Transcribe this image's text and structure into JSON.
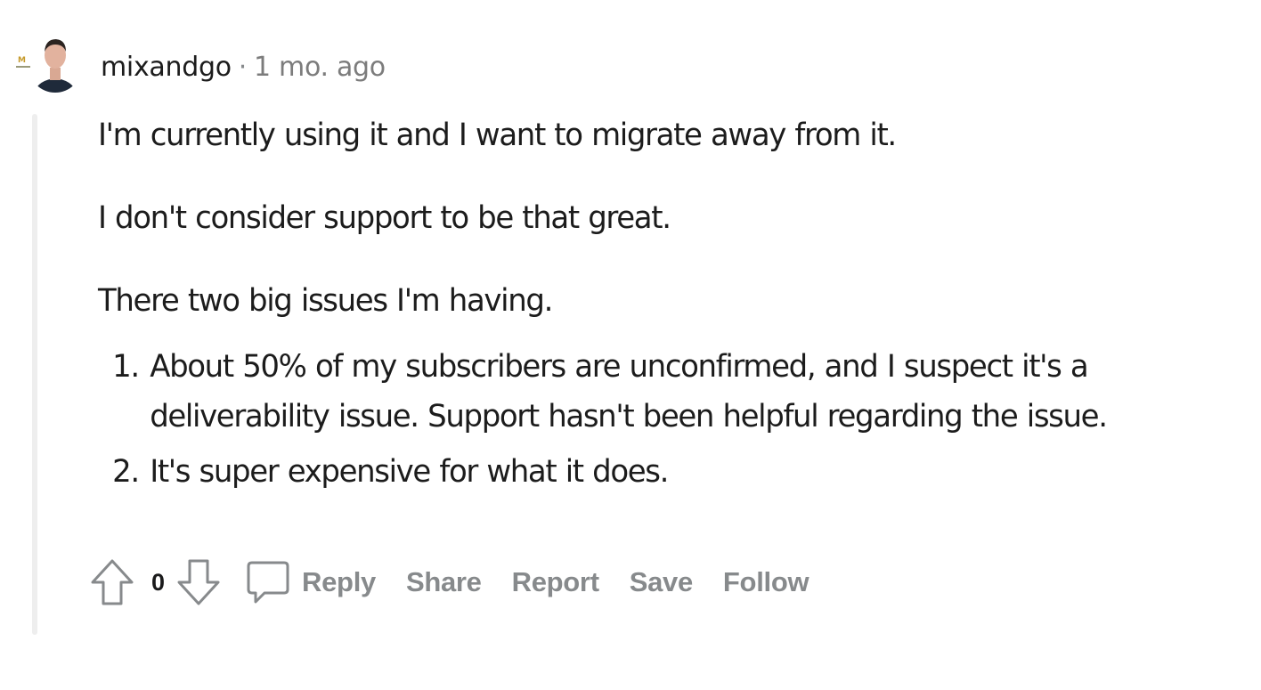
{
  "comment": {
    "author": "mixandgo",
    "separator": "·",
    "timestamp": "1 mo. ago",
    "avatar_icon": "user-avatar-photo",
    "paragraphs": [
      "I'm currently using it and I want to migrate away from it.",
      "I don't consider support to be that great.",
      "There two big issues I'm having."
    ],
    "list_items": [
      "About 50% of my subscribers are unconfirmed, and I suspect it's a deliverability issue. Support hasn't been helpful regarding the issue.",
      "It's super expensive for what it does."
    ],
    "vote_count": "0",
    "actions": {
      "upvote_icon": "arrow-up-outline-icon",
      "downvote_icon": "arrow-down-outline-icon",
      "comment_icon": "speech-bubble-icon",
      "reply": "Reply",
      "share": "Share",
      "report": "Report",
      "save": "Save",
      "follow": "Follow"
    }
  },
  "colors": {
    "text": "#1c1c1c",
    "meta": "#7c7c7c",
    "action": "#878a8c",
    "thread_line": "#eeeeee"
  }
}
